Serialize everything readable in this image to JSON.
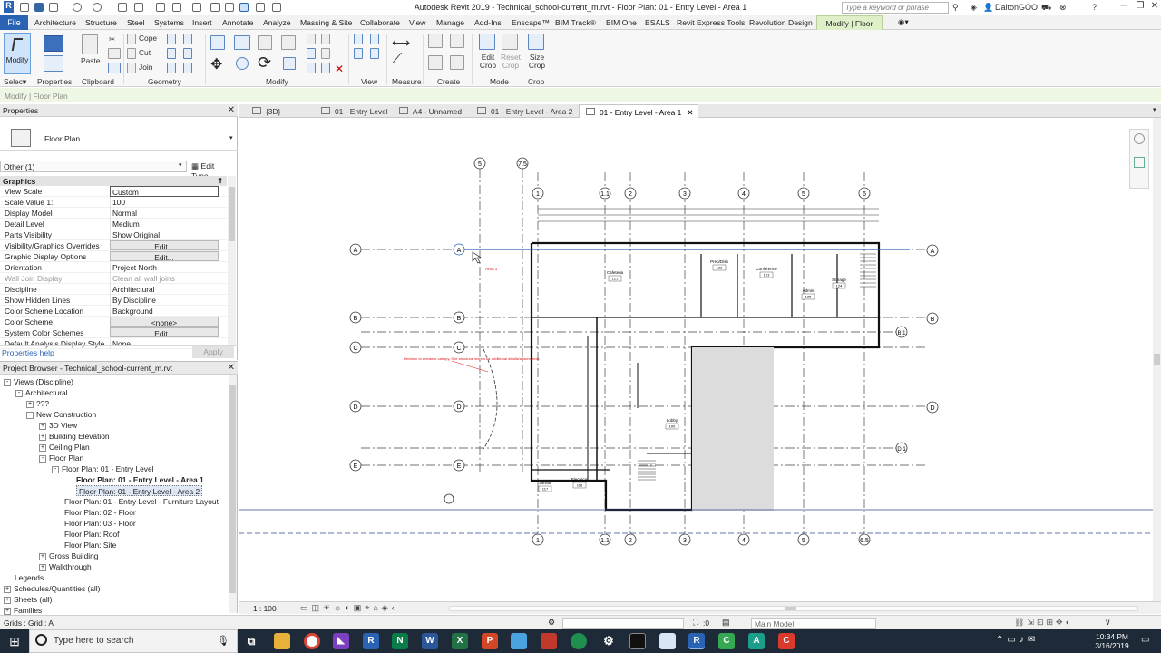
{
  "titlebar": {
    "title": "Autodesk Revit 2019 - Technical_school-current_m.rvt - Floor Plan: 01 - Entry Level - Area 1",
    "search_placeholder": "Type a keyword or phrase",
    "user": "DaltonGOO",
    "app_letter": "R"
  },
  "menu": {
    "file": "File",
    "tabs": [
      "Architecture",
      "Structure",
      "Steel",
      "Systems",
      "Insert",
      "Annotate",
      "Analyze",
      "Massing & Site",
      "Collaborate",
      "View",
      "Manage",
      "Add-Ins",
      "Enscape™",
      "BIM Track®",
      "BIM One",
      "BSALS",
      "Revit Express Tools",
      "Revolution Design"
    ],
    "context_tab": "Modify | Floor Plan"
  },
  "ribbon": {
    "modify_label": "Modify",
    "paste_label": "Paste",
    "cope": "Cope",
    "cut": "Cut",
    "join": "Join",
    "edit_crop": "Edit Crop",
    "reset_crop": "Reset Crop",
    "size_crop": "Size Crop",
    "panels": {
      "select": "Select",
      "properties": "Properties",
      "clipboard": "Clipboard",
      "geometry": "Geometry",
      "modify": "Modify",
      "view": "View",
      "measure": "Measure",
      "create": "Create",
      "mode": "Mode",
      "crop": "Crop"
    }
  },
  "context_line": "Modify | Floor Plan",
  "properties": {
    "title": "Properties",
    "type_name": "Floor Plan",
    "filter": "Other (1)",
    "edit_type": "Edit Type",
    "group": "Graphics",
    "rows": [
      {
        "k": "View Scale",
        "v": "Custom"
      },
      {
        "k": "Scale Value    1:",
        "v": "100"
      },
      {
        "k": "Display Model",
        "v": "Normal"
      },
      {
        "k": "Detail Level",
        "v": "Medium"
      },
      {
        "k": "Parts Visibility",
        "v": "Show Original"
      },
      {
        "k": "Visibility/Graphics Overrides",
        "v": "Edit..."
      },
      {
        "k": "Graphic Display Options",
        "v": "Edit..."
      },
      {
        "k": "Orientation",
        "v": "Project North"
      },
      {
        "k": "Wall Join Display",
        "v": "Clean all wall joins"
      },
      {
        "k": "Discipline",
        "v": "Architectural"
      },
      {
        "k": "Show Hidden Lines",
        "v": "By Discipline"
      },
      {
        "k": "Color Scheme Location",
        "v": "Background"
      },
      {
        "k": "Color Scheme",
        "v": "<none>"
      },
      {
        "k": "System Color Schemes",
        "v": "Edit..."
      },
      {
        "k": "Default Analysis Display Style",
        "v": "None"
      }
    ],
    "help": "Properties help",
    "apply": "Apply"
  },
  "browser": {
    "title": "Project Browser - Technical_school-current_m.rvt",
    "nodes": [
      {
        "t": "Views (Discipline)",
        "lvl": 0,
        "tog": "-"
      },
      {
        "t": "Architectural",
        "lvl": 1,
        "tog": "-"
      },
      {
        "t": "???",
        "lvl": 2,
        "tog": "+"
      },
      {
        "t": "New Construction",
        "lvl": 2,
        "tog": "-"
      },
      {
        "t": "3D View",
        "lvl": 3,
        "tog": "+"
      },
      {
        "t": "Building Elevation",
        "lvl": 3,
        "tog": "+"
      },
      {
        "t": "Ceiling Plan",
        "lvl": 3,
        "tog": "+"
      },
      {
        "t": "Floor Plan",
        "lvl": 3,
        "tog": "-"
      },
      {
        "t": "Floor Plan: 01 - Entry Level",
        "lvl": 4,
        "tog": "-"
      },
      {
        "t": "Floor Plan: 01 - Entry Level - Area 1",
        "lvl": 5,
        "tog": "",
        "bold": true
      },
      {
        "t": "Floor Plan: 01 - Entry Level - Area 2",
        "lvl": 5,
        "tog": "",
        "sel": true
      },
      {
        "t": "Floor Plan: 01 - Entry Level - Furniture Layout",
        "lvl": 4,
        "tog": ""
      },
      {
        "t": "Floor Plan: 02 - Floor",
        "lvl": 4,
        "tog": ""
      },
      {
        "t": "Floor Plan: 03 - Floor",
        "lvl": 4,
        "tog": ""
      },
      {
        "t": "Floor Plan: Roof",
        "lvl": 4,
        "tog": ""
      },
      {
        "t": "Floor Plan: Site",
        "lvl": 4,
        "tog": ""
      },
      {
        "t": "Gross Building",
        "lvl": 3,
        "tog": "+"
      },
      {
        "t": "Walkthrough",
        "lvl": 3,
        "tog": "+"
      },
      {
        "t": "Legends",
        "lvl": 0,
        "tog": ""
      },
      {
        "t": "Schedules/Quantities (all)",
        "lvl": 0,
        "tog": "+"
      },
      {
        "t": "Sheets (all)",
        "lvl": 0,
        "tog": "+"
      },
      {
        "t": "Families",
        "lvl": 0,
        "tog": "+"
      }
    ]
  },
  "viewtabs": [
    {
      "label": "{3D}",
      "active": false
    },
    {
      "label": "01 - Entry Level",
      "active": false
    },
    {
      "label": "A4 - Unnamed",
      "active": false
    },
    {
      "label": "01 - Entry Level - Area 2",
      "active": false
    },
    {
      "label": "01 - Entry Level - Area 1",
      "active": true
    }
  ],
  "plan": {
    "grid_cols_top": [
      "5",
      "7.5"
    ],
    "grid_cols": [
      "1",
      "1.1",
      "2",
      "3",
      "4",
      "5",
      "6"
    ],
    "grid_cols_bottom": [
      "1",
      "1.1",
      "2",
      "3",
      "4",
      "5",
      "6.5"
    ],
    "grid_rows": [
      "A",
      "B",
      "C",
      "D",
      "E"
    ],
    "grid_rows_right": [
      "A",
      "B",
      "D"
    ],
    "grid_extra": [
      "B.1",
      "D.1"
    ],
    "rooms": [
      {
        "name": "Cafeteria",
        "num": "121"
      },
      {
        "name": "Prep/Dish",
        "num": "122"
      },
      {
        "name": "Conference",
        "num": "123"
      },
      {
        "name": "Storage",
        "num": "124"
      },
      {
        "name": "Admin",
        "num": "125"
      },
      {
        "name": "Lobby",
        "num": "100"
      },
      {
        "name": "Electrical",
        "num": "118"
      },
      {
        "name": "Janitor",
        "num": "117"
      }
    ],
    "annotation_red": "Area 1",
    "note_red": "Revision to entrance canopy. See structural sheets for additional details/attachments"
  },
  "viewcontrol": {
    "scale": "1 : 100"
  },
  "status": {
    "text": "Grids : Grid : A",
    "main_model": "Main Model",
    "sel_count": ":0"
  },
  "taskbar": {
    "search": "Type here to search",
    "time": "10:34 PM",
    "date": "3/16/2019"
  }
}
